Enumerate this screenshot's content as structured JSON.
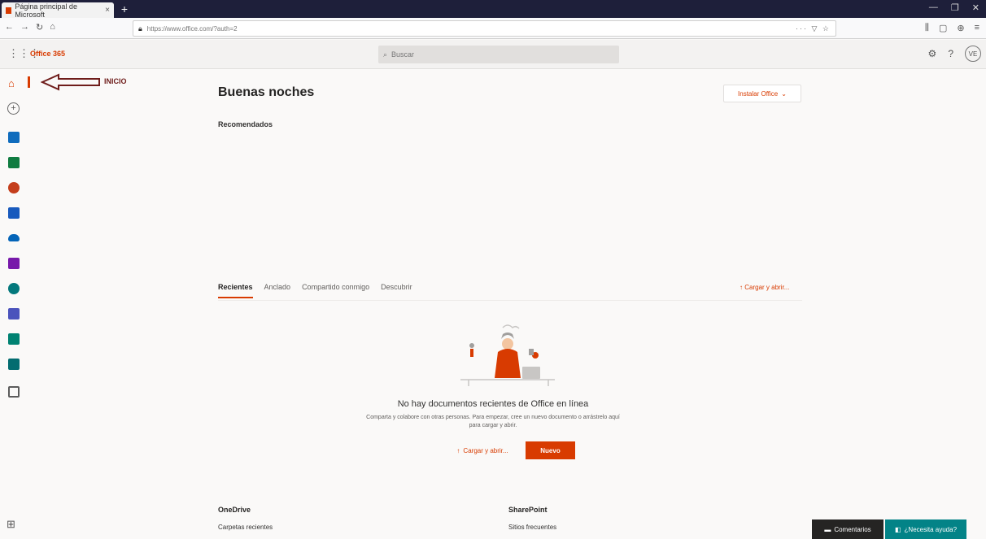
{
  "browser": {
    "tab_title": "Página principal de Microsoft",
    "tab_close": "×",
    "new_tab": "+",
    "url": "https://www.office.com/?auth=2",
    "nav": {
      "back": "←",
      "forward": "→",
      "reload": "↻",
      "home": "⌂"
    },
    "url_actions": "··· ▽ ☆",
    "toolbar_icons": [
      "⫼",
      "▢",
      "⊕",
      "≡"
    ],
    "window_controls": [
      "—",
      "❐",
      "✕"
    ]
  },
  "office_header": {
    "waffle": "⋮⋮⋮",
    "brand": "Office 365",
    "search_placeholder": "Buscar",
    "search_icon": "⌕",
    "settings_icon": "⚙",
    "help_icon": "?",
    "avatar_initials": "VE"
  },
  "rail": {
    "home_icon": "⌂",
    "create_icon": "+",
    "all_apps_icon": "⊞",
    "apps": [
      {
        "name": "outlook",
        "color": "#0f6cbd"
      },
      {
        "name": "excel",
        "color": "#107c41"
      },
      {
        "name": "powerpoint",
        "color": "#c43e1c"
      },
      {
        "name": "word",
        "color": "#185abd"
      },
      {
        "name": "onedrive",
        "color": "#0364b8"
      },
      {
        "name": "onenote",
        "color": "#7719aa"
      },
      {
        "name": "sharepoint",
        "color": "#03787c"
      },
      {
        "name": "teams",
        "color": "#4b53bc"
      },
      {
        "name": "sway",
        "color": "#008272"
      },
      {
        "name": "forms",
        "color": "#036c70"
      },
      {
        "name": "admin",
        "color": "#5c5c5c"
      }
    ]
  },
  "annotation": {
    "label": "INICIO"
  },
  "main": {
    "greeting": "Buenas noches",
    "install_office": "Instalar Office",
    "install_chevron": "⌄",
    "recommended": "Recomendados",
    "tabs": [
      {
        "label": "Recientes",
        "active": true
      },
      {
        "label": "Anclado",
        "active": false
      },
      {
        "label": "Compartido conmigo",
        "active": false
      },
      {
        "label": "Descubrir",
        "active": false
      }
    ],
    "upload_link": "Cargar y abrir...",
    "upload_icon": "↑",
    "empty_title": "No hay documentos recientes de Office en línea",
    "empty_subtitle": "Comparta y colabore con otras personas. Para empezar, cree un nuevo documento o arrástrelo aquí para cargar y abrir.",
    "upload_button": "Cargar y abrir...",
    "new_button": "Nuevo"
  },
  "sections": {
    "onedrive": {
      "title": "OneDrive",
      "link": "Carpetas recientes"
    },
    "sharepoint": {
      "title": "SharePoint",
      "link": "Sitios frecuentes"
    }
  },
  "footer": {
    "feedback": "Comentarios",
    "feedback_icon": "▬",
    "help": "¿Necesita ayuda?",
    "help_icon": "◧"
  },
  "colors": {
    "accent": "#d83b01",
    "annotation": "#6f1d1b",
    "help_teal": "#038387"
  }
}
